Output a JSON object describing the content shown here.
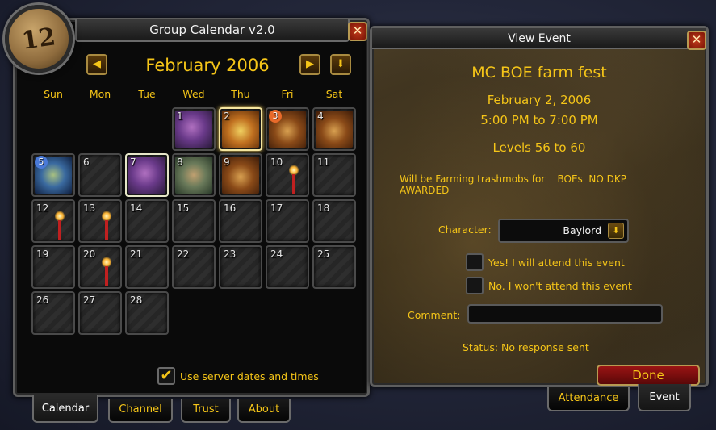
{
  "calendar_window": {
    "title": "Group Calendar v2.0",
    "portrait_number": "12",
    "close_label": "✕",
    "month_title": "February 2006",
    "prev_month_glyph": "◀",
    "next_month_glyph": "▶",
    "today_glyph": "⬇",
    "days_of_week": [
      "Sun",
      "Mon",
      "Tue",
      "Wed",
      "Thu",
      "Fri",
      "Sat"
    ],
    "days": [
      {
        "num": "1",
        "event_icon": "purple-creature-icon",
        "badge": ""
      },
      {
        "num": "2",
        "event_icon": "gold-orc-icon",
        "badge": ""
      },
      {
        "num": "3",
        "event_icon": "orc-icon",
        "badge": "orange"
      },
      {
        "num": "4",
        "event_icon": "orc-icon",
        "badge": ""
      },
      {
        "num": "5",
        "event_icon": "dragonkin-icon",
        "badge": "blue"
      },
      {
        "num": "6",
        "event_icon": "",
        "badge": ""
      },
      {
        "num": "7",
        "event_icon": "purple-creature-icon",
        "badge": ""
      },
      {
        "num": "8",
        "event_icon": "gnome-icon",
        "badge": ""
      },
      {
        "num": "9",
        "event_icon": "orc-icon",
        "badge": ""
      },
      {
        "num": "10",
        "event_icon": "candle-icon",
        "badge": ""
      },
      {
        "num": "11",
        "event_icon": "",
        "badge": ""
      },
      {
        "num": "12",
        "event_icon": "candle-icon",
        "badge": ""
      },
      {
        "num": "13",
        "event_icon": "candle-icon",
        "badge": ""
      },
      {
        "num": "14",
        "event_icon": "",
        "badge": ""
      },
      {
        "num": "15",
        "event_icon": "",
        "badge": ""
      },
      {
        "num": "16",
        "event_icon": "",
        "badge": ""
      },
      {
        "num": "17",
        "event_icon": "",
        "badge": ""
      },
      {
        "num": "18",
        "event_icon": "",
        "badge": ""
      },
      {
        "num": "19",
        "event_icon": "",
        "badge": ""
      },
      {
        "num": "20",
        "event_icon": "candle-icon",
        "badge": ""
      },
      {
        "num": "21",
        "event_icon": "",
        "badge": ""
      },
      {
        "num": "22",
        "event_icon": "",
        "badge": ""
      },
      {
        "num": "23",
        "event_icon": "",
        "badge": ""
      },
      {
        "num": "24",
        "event_icon": "",
        "badge": ""
      },
      {
        "num": "25",
        "event_icon": "",
        "badge": ""
      },
      {
        "num": "26",
        "event_icon": "",
        "badge": ""
      },
      {
        "num": "27",
        "event_icon": "",
        "badge": ""
      },
      {
        "num": "28",
        "event_icon": "",
        "badge": ""
      }
    ],
    "first_weekday_index": 3,
    "selected_day": "2",
    "today_day": "7",
    "server_time_checkbox": {
      "label": "Use server dates and times",
      "checked": true,
      "check_glyph": "✔"
    },
    "tabs": [
      "Calendar",
      "Channel",
      "Trust",
      "About"
    ],
    "active_tab": "Calendar"
  },
  "event_window": {
    "title": "View Event",
    "close_label": "✕",
    "event_name": "MC BOE farm fest",
    "date": "February 2, 2006",
    "time": "5:00 PM to 7:00 PM",
    "levels": "Levels 56 to 60",
    "description": "Will be Farming trashmobs for    BOEs  NO DKP\nAWARDED",
    "character_label": "Character:",
    "character_value": "Baylord",
    "dropdown_glyph": "⬇",
    "attend_yes": "Yes! I will attend this event",
    "attend_no": "No. I won't attend this event",
    "comment_label": "Comment:",
    "comment_value": "",
    "status": "Status: No response sent",
    "done_label": "Done",
    "tabs": [
      "Attendance",
      "Event"
    ],
    "active_tab": "Event"
  },
  "colors": {
    "gold_text": "#f5c518",
    "frame_border": "#5e5e5e",
    "done_button": "#9a1414"
  }
}
